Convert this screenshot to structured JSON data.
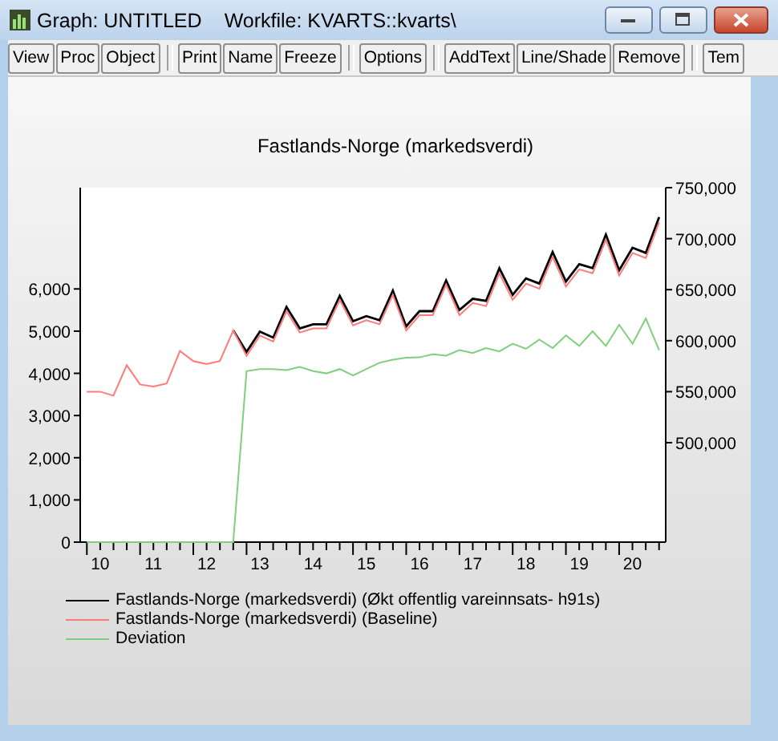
{
  "window": {
    "title": "Graph: UNTITLED",
    "workfile": "Workfile: KVARTS::kvarts\\"
  },
  "toolbar": [
    [
      "View",
      "Proc",
      "Object"
    ],
    [
      "Print",
      "Name",
      "Freeze"
    ],
    [
      "Options"
    ],
    [
      "AddText",
      "Line/Shade",
      "Remove"
    ],
    [
      "Tem"
    ]
  ],
  "graph": {
    "chart_data": {
      "type": "line",
      "title": "Fastlands-Norge (markedsverdi)",
      "categories": [
        null,
        "10",
        null,
        null,
        null,
        "11",
        null,
        null,
        null,
        "12",
        null,
        null,
        null,
        "13",
        null,
        null,
        null,
        "14",
        null,
        null,
        null,
        "15",
        null,
        null,
        null,
        "16",
        null,
        null,
        null,
        "17",
        null,
        null,
        null,
        "18",
        null,
        null,
        null,
        "19",
        null,
        null,
        null,
        "20",
        null,
        null
      ],
      "ylim": [
        0,
        8400
      ],
      "yticks": [
        {
          "value": 0,
          "label": "0"
        },
        {
          "value": 1000,
          "label": "1,000"
        },
        {
          "value": 2000,
          "label": "2,000"
        },
        {
          "value": 3000,
          "label": "3,000"
        },
        {
          "value": 4000,
          "label": "4,000"
        },
        {
          "value": 5000,
          "label": "5,000"
        },
        {
          "value": 6000,
          "label": "6,000"
        }
      ],
      "y2lim": [
        402500,
        750000
      ],
      "y2ticks": [
        {
          "value": 500000,
          "label": "500,000"
        },
        {
          "value": 550000,
          "label": "550,000"
        },
        {
          "value": 600000,
          "label": "600,000"
        },
        {
          "value": 650000,
          "label": "650,000"
        },
        {
          "value": 700000,
          "label": "700,000"
        },
        {
          "value": 750000,
          "label": "750,000"
        }
      ],
      "series": [
        {
          "name": "Fastlands-Norge (markedsverdi) (Økt offentlig vareinnsats- h91s)",
          "color": "#000000",
          "axis": "y2",
          "values": [
            null,
            null,
            null,
            null,
            null,
            null,
            null,
            null,
            null,
            null,
            null,
            610000,
            589000,
            609000,
            603000,
            633000,
            612000,
            616000,
            616000,
            644000,
            619000,
            624000,
            620000,
            649000,
            614000,
            629000,
            629000,
            659000,
            630000,
            641000,
            639000,
            671000,
            645000,
            661000,
            656000,
            687000,
            658000,
            675000,
            671000,
            704000,
            669000,
            691000,
            686000,
            721000
          ]
        },
        {
          "name": "Fastlands-Norge (markedsverdi) (Baseline)",
          "color": "#ff7a7a",
          "axis": "y2",
          "values": [
            550000,
            550000,
            546000,
            576000,
            557000,
            555000,
            558000,
            590000,
            580000,
            577000,
            580000,
            610000,
            585000,
            605000,
            599000,
            629000,
            608000,
            612000,
            612000,
            640000,
            615000,
            620000,
            616000,
            645000,
            610000,
            625000,
            625000,
            655000,
            625000,
            637000,
            634000,
            666000,
            640000,
            656000,
            651000,
            682000,
            653000,
            670000,
            666000,
            699000,
            664000,
            686000,
            681000,
            716000
          ]
        },
        {
          "name": "Deviation",
          "color": "#7fcf7f",
          "values": [
            0,
            0,
            0,
            0,
            0,
            0,
            0,
            0,
            0,
            0,
            0,
            0,
            4050,
            4100,
            4100,
            4080,
            4150,
            4050,
            4000,
            4100,
            3950,
            4100,
            4250,
            4320,
            4370,
            4380,
            4450,
            4420,
            4550,
            4480,
            4600,
            4520,
            4700,
            4580,
            4800,
            4600,
            4900,
            4650,
            5000,
            4650,
            5150,
            4700,
            5300,
            4550
          ]
        }
      ]
    }
  }
}
